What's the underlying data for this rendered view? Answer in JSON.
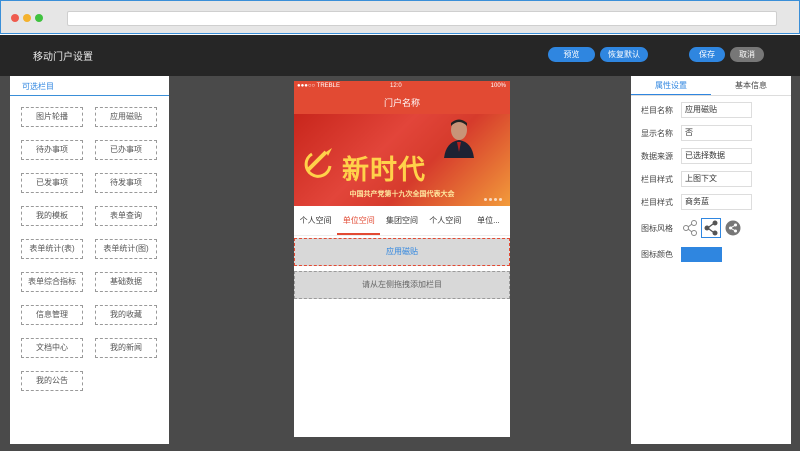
{
  "browser": {
    "dots": [
      "#ef5b4e",
      "#f4b22e",
      "#3fc23f"
    ]
  },
  "header": {
    "title": "移动门户设置",
    "preview_label": "预览",
    "restore_label": "恢复默认",
    "save_label": "保存",
    "cancel_label": "取消"
  },
  "left_panel": {
    "tab_label": "可选栏目",
    "widgets": [
      "图片轮播",
      "应用磁贴",
      "待办事项",
      "已办事项",
      "已发事项",
      "待发事项",
      "我的模板",
      "表单查询",
      "表单统计(表)",
      "表单统计(图)",
      "表单综合指标",
      "基础数据",
      "信息管理",
      "我的收藏",
      "文档中心",
      "我的新闻",
      "我的公告"
    ]
  },
  "phone": {
    "carrier": "●●●○○ TREBLE",
    "time": "12:0",
    "battery": "100%",
    "title": "门户名称",
    "banner_text": "新时代",
    "banner_subtitle": "中国共产党第十九次全国代表大会",
    "tabs": [
      "个人空间",
      "单位空间",
      "集团空间",
      "个人空间",
      "单位..."
    ],
    "active_tab": 1,
    "selected_block_label": "应用磁贴",
    "drop_hint": "请从左侧拖拽添加栏目"
  },
  "right_panel": {
    "tab_properties": "属性设置",
    "tab_basic": "基本信息",
    "fields": [
      {
        "label": "栏目名称",
        "value": "应用磁贴"
      },
      {
        "label": "显示名称",
        "value": "否"
      },
      {
        "label": "数据来源",
        "value": "已选择数据"
      },
      {
        "label": "栏目样式",
        "value": "上图下文"
      },
      {
        "label": "栏目样式",
        "value": "商务蓝"
      }
    ],
    "icon_style_label": "图标风格",
    "icon_color_label": "图标颜色",
    "icon_color": "#2f86e0",
    "icon_styles": [
      "share-outline-icon",
      "share-filled-icon",
      "share-circle-icon"
    ]
  }
}
